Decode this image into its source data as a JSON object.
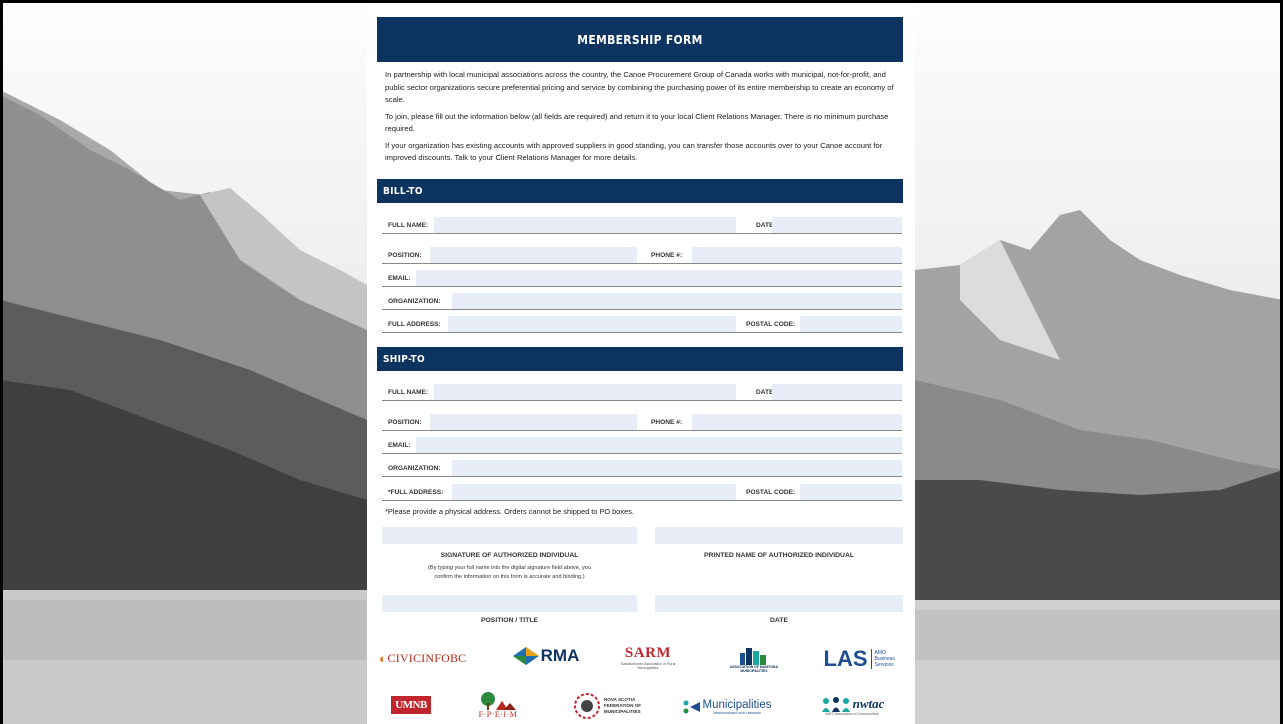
{
  "form": {
    "title": "MEMBERSHIP FORM",
    "intro": [
      "In partnership with local municipal associations across the country, the Canoe Procurement Group of Canada works with municipal, not-for-profit, and public sector organizations secure preferential pricing and service by combining the purchasing power of its entire membership to create an economy of scale.",
      "To join, please fill out the information below (all fields are required) and return it to your local Client Relations Manager. There is no minimum purchase required.",
      "If your organization has existing accounts with approved suppliers in good standing, you can transfer those accounts over to your Canoe account for improved discounts. Talk to your Client Relations Manager for more details."
    ],
    "bill_to": {
      "heading": "BILL-TO",
      "full_name": "FULL NAME:",
      "date": "DATE:",
      "position": "POSITION:",
      "phone": "PHONE #:",
      "email": "EMAIL:",
      "organization": "ORGANIZATION:",
      "full_address": "FULL ADDRESS:",
      "postal_code": "POSTAL CODE:"
    },
    "ship_to": {
      "heading": "SHIP-TO",
      "full_name": "FULL NAME:",
      "date": "DATE:",
      "position": "POSITION:",
      "phone": "PHONE #:",
      "email": "EMAIL:",
      "organization": "ORGANIZATION:",
      "full_address": "*FULL ADDRESS:",
      "postal_code": "POSTAL CODE:"
    },
    "po_note": "*Please provide a physical address. Orders cannot be shipped to PO boxes.",
    "signature_label": "SIGNATURE OF AUTHORIZED INDIVIDUAL",
    "signature_note_1": "(By typing your full name into the digital signature field above, you",
    "signature_note_2": "confirm the information on this form is accurate and binding.)",
    "printed_name_label": "PRINTED NAME OF AUTHORIZED INDIVIDUAL",
    "position_title_label": "POSITION / TITLE",
    "date_label": "DATE"
  },
  "logos": {
    "civicinfo": "CIVICINFOBC",
    "rma": "RMA",
    "sarm": "SARM",
    "sarm_sub": "Saskatchewan Association of Rural Municipalities",
    "amm": "ASSOCIATION OF MANITOBA MUNICIPALITIES",
    "las": "LAS",
    "las_sub": "AMO Business Services",
    "unb": "UMNB",
    "fpeim": "F·P·E·I·M",
    "ns_1": "NOVA SCOTIA",
    "ns_2": "FEDERATION OF",
    "ns_3": "MUNICIPALITIES",
    "mnl": "Municipalities",
    "mnl_sub": "Newfoundland and Labrador",
    "nwtac": "nwtac",
    "nwtac_sub": "NWT Association of Communities",
    "colors": {
      "navy": "#0d3461",
      "civic_orange": "#e8711a",
      "civic_red": "#b52a1c",
      "las_blue": "#1d4f91",
      "red": "#c0272d",
      "teal": "#1aa8a0"
    }
  }
}
